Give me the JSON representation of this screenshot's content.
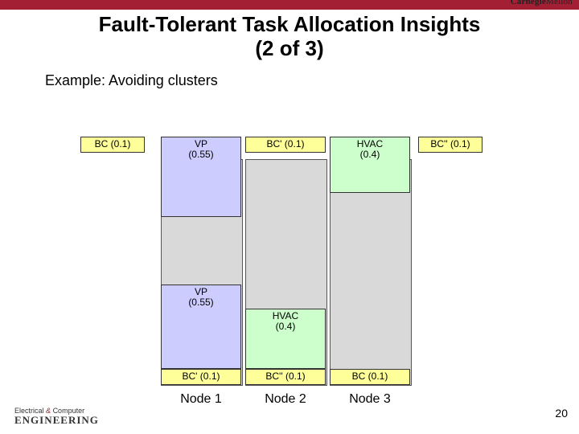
{
  "brand": {
    "name_part1": "Carnegie",
    "name_part2": "Mellon"
  },
  "title_line1": "Fault-Tolerant Task Allocation Insights",
  "title_line2": "(2 of 3)",
  "example_label": "Example: Avoiding clusters",
  "top_row": {
    "bc": "BC (0.1)",
    "vp_l1": "VP",
    "vp_l2": "(0.55)",
    "bc1": "BC' (0.1)",
    "hvac_l1": "HVAC",
    "hvac_l2": "(0.4)",
    "bc2": "BC'' (0.1)"
  },
  "stacks": {
    "node1": {
      "vp_l1": "VP",
      "vp_l2": "(0.55)",
      "bottom": "BC' (0.1)"
    },
    "node2": {
      "hvac_l1": "HVAC",
      "hvac_l2": "(0.4)",
      "bottom": "BC'' (0.1)"
    },
    "node3": {
      "bottom": "BC (0.1)"
    }
  },
  "node_labels": {
    "n1": "Node 1",
    "n2": "Node 2",
    "n3": "Node 3"
  },
  "footer": {
    "dept_line1_a": "Electrical",
    "amp": "&",
    "dept_line1_b": "Computer",
    "dept_line2": "ENGINEERING"
  },
  "slide_number": "20"
}
